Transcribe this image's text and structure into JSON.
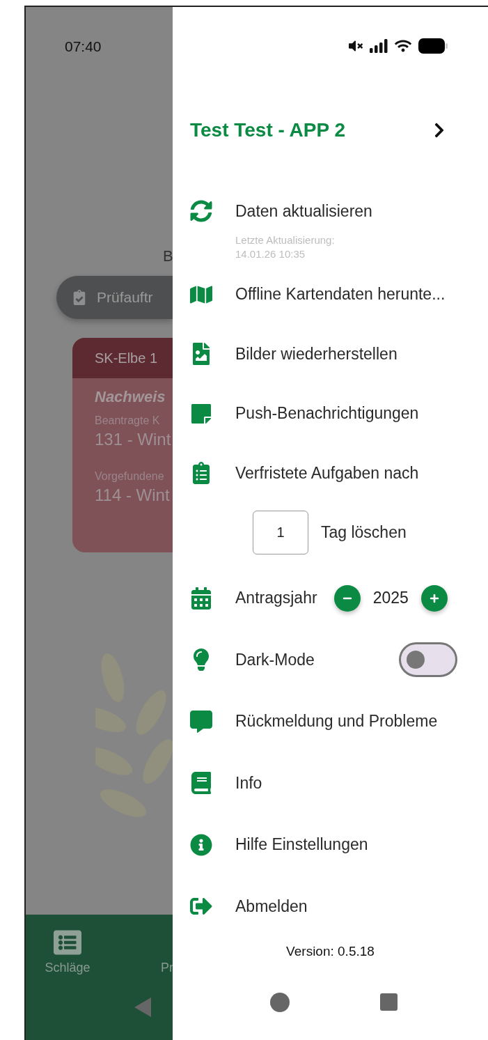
{
  "status_bar": {
    "time": "07:40"
  },
  "background": {
    "heading": "B",
    "filter_chip": "Prüfauftr",
    "card": {
      "title": "SK-Elbe 1",
      "subtitle": "Nachweis",
      "fields": [
        {
          "label": "Beantragte K",
          "value": "131 - Wint"
        },
        {
          "label": "Vorgefundene",
          "value": "114 - Wint"
        }
      ]
    },
    "bottom_nav": [
      {
        "label": "Schläge"
      },
      {
        "label": "Pr"
      }
    ]
  },
  "drawer": {
    "user": "Test Test - APP 2",
    "items": [
      {
        "kind": "action",
        "label": "Daten aktualisieren",
        "note": "Letzte Aktualisierung: 14.01.26 10:35"
      },
      {
        "kind": "action",
        "label": "Offline Kartendaten herunte..."
      },
      {
        "kind": "action",
        "label": "Bilder wiederherstellen"
      },
      {
        "kind": "action",
        "label": "Push-Benachrichtigungen"
      },
      {
        "kind": "retention",
        "label": "Verfristete Aufgaben nach",
        "value": "1",
        "suffix": "Tag löschen"
      },
      {
        "kind": "stepper",
        "label": "Antragsjahr",
        "value": "2025"
      },
      {
        "kind": "toggle",
        "label": "Dark-Mode",
        "on": false
      },
      {
        "kind": "action",
        "label": "Rückmeldung und Probleme"
      },
      {
        "kind": "action",
        "label": "Info"
      },
      {
        "kind": "action",
        "label": "Hilfe Einstellungen"
      },
      {
        "kind": "action",
        "label": "Abmelden"
      }
    ],
    "version": "Version: 0.5.18"
  }
}
